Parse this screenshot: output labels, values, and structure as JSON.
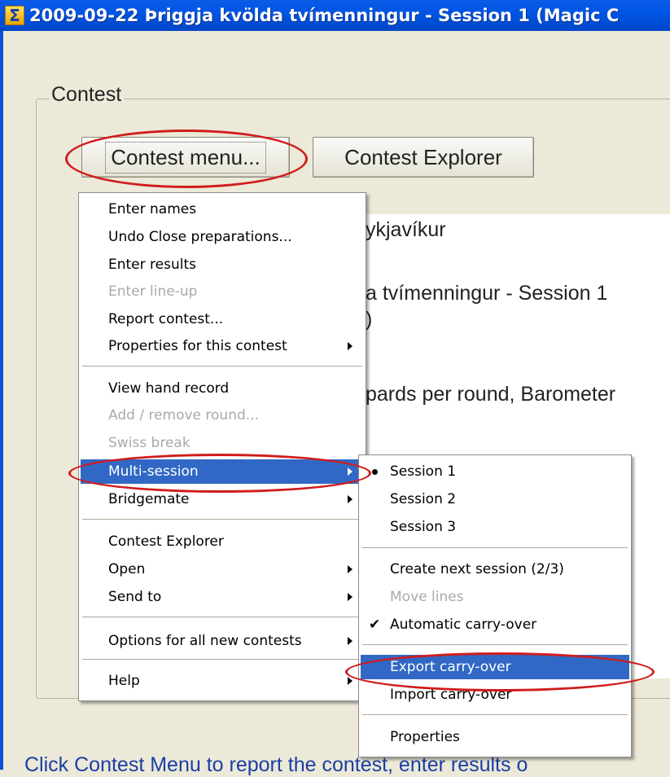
{
  "window": {
    "title": "2009-09-22  Þriggja kvölda tvímenningur - Session 1  (Magic C",
    "icon": "sigma-icon"
  },
  "contest": {
    "group_label": "Contest",
    "contest_menu_button": "Contest menu...",
    "contest_explorer_button": "Contest Explorer"
  },
  "info": {
    "line1": "ykjavíkur",
    "line2": "a tvímenningur - Session 1",
    "line3": ")",
    "line4": "pards per round, Barometer"
  },
  "main_menu": {
    "items": [
      {
        "label": "Enter names"
      },
      {
        "label": "Undo Close preparations..."
      },
      {
        "label": "Enter results"
      },
      {
        "label": "Enter line-up"
      },
      {
        "label": "Report contest..."
      },
      {
        "label": "Properties for this contest"
      },
      {
        "label": "View hand record"
      },
      {
        "label": "Add / remove round..."
      },
      {
        "label": "Swiss break"
      },
      {
        "label": "Multi-session"
      },
      {
        "label": "Bridgemate"
      },
      {
        "label": "Contest Explorer"
      },
      {
        "label": "Open"
      },
      {
        "label": "Send to"
      },
      {
        "label": "Options for all new contests"
      },
      {
        "label": "Help"
      }
    ]
  },
  "sub_menu": {
    "items": [
      {
        "label": "Session 1"
      },
      {
        "label": "Session 2"
      },
      {
        "label": "Session 3"
      },
      {
        "label": "Create next session (2/3)"
      },
      {
        "label": "Move lines"
      },
      {
        "label": "Automatic carry-over"
      },
      {
        "label": "Export carry-over"
      },
      {
        "label": "Import carry-over"
      },
      {
        "label": "Properties"
      }
    ]
  },
  "hint": "Click Contest Menu to report the contest, enter results o",
  "colors": {
    "titlebar": "#0055e5",
    "highlight": "#3168c5",
    "annotation": "#d01c1c",
    "hint_text": "#1a3fa6"
  }
}
